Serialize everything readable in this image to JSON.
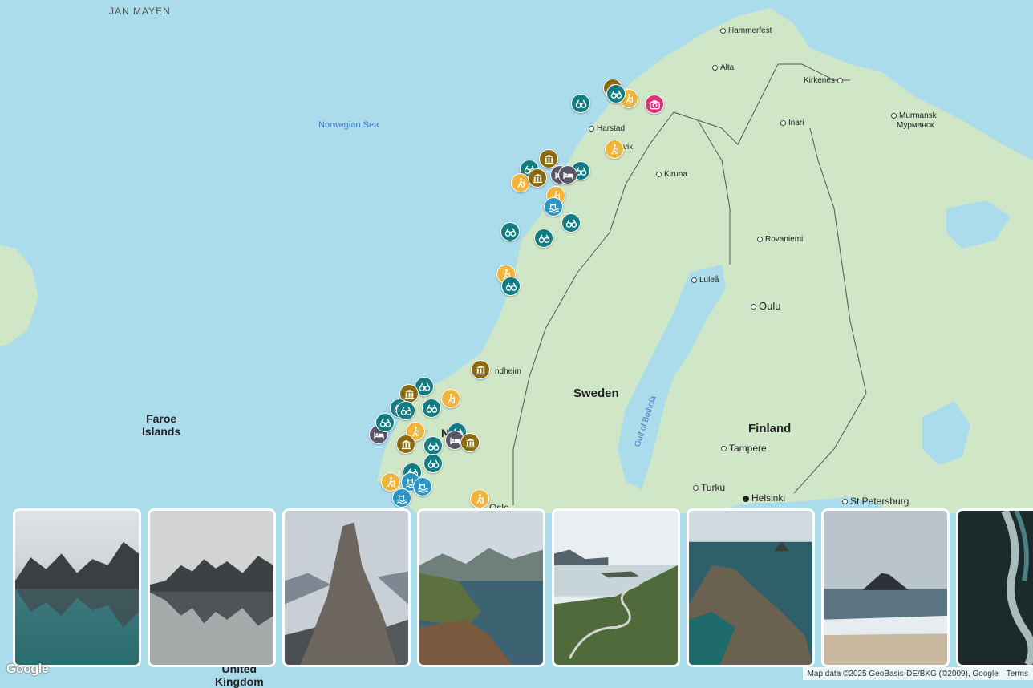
{
  "map": {
    "labels": {
      "jan_mayen": "JAN MAYEN",
      "norwegian_sea": "Norwegian Sea",
      "hammerfest": "Hammerfest",
      "alta": "Alta",
      "kirkenes": "Kirkenes",
      "murmansk_1": "Murmansk",
      "murmansk_2": "Мурманск",
      "inari": "Inari",
      "harstad": "Harstad",
      "narvik_partial": "vik",
      "kiruna": "Kiruna",
      "rovaniemi": "Rovaniemi",
      "lulea": "Luleå",
      "oulu": "Oulu",
      "trondheim_partial": "ndheim",
      "sweden": "Sweden",
      "finland": "Finland",
      "norway_partial": "Nay",
      "gulf_of_bothnia": "Gulf of Bothnia",
      "tampere": "Tampere",
      "turku": "Turku",
      "helsinki": "Helsinki",
      "st_petersburg": "St Petersburg",
      "oslo_partial": "Oslo",
      "faroe_1": "Faroe",
      "faroe_2": "Islands",
      "united_kingdom_1": "United",
      "united_kingdom_2": "Kingdom"
    },
    "pin_colors": {
      "viewpoint": "#117c81",
      "museum": "#8a6a10",
      "hiking": "#f0b43a",
      "lodging": "#5a5668",
      "swimming": "#2b95c4",
      "photo": "#e0307a"
    },
    "pins": [
      {
        "type": "viewpoint",
        "icon": "binoculars-icon"
      },
      {
        "type": "museum",
        "icon": "museum-icon"
      },
      {
        "type": "hiking",
        "icon": "hiking-icon"
      },
      {
        "type": "photo",
        "icon": "camera-icon"
      },
      {
        "type": "viewpoint",
        "icon": "binoculars-icon"
      },
      {
        "type": "hiking",
        "icon": "hiking-icon"
      },
      {
        "type": "museum",
        "icon": "museum-icon"
      },
      {
        "type": "viewpoint",
        "icon": "binoculars-icon"
      },
      {
        "type": "lodging",
        "icon": "bed-icon"
      },
      {
        "type": "viewpoint",
        "icon": "binoculars-icon"
      },
      {
        "type": "hiking",
        "icon": "hiking-icon"
      },
      {
        "type": "hiking",
        "icon": "hiking-icon"
      },
      {
        "type": "swimming",
        "icon": "swimming-icon"
      },
      {
        "type": "viewpoint",
        "icon": "binoculars-icon"
      },
      {
        "type": "viewpoint",
        "icon": "binoculars-icon"
      },
      {
        "type": "viewpoint",
        "icon": "binoculars-icon"
      },
      {
        "type": "hiking",
        "icon": "hiking-icon"
      },
      {
        "type": "viewpoint",
        "icon": "binoculars-icon"
      },
      {
        "type": "museum",
        "icon": "museum-icon"
      },
      {
        "type": "viewpoint",
        "icon": "binoculars-icon"
      },
      {
        "type": "museum",
        "icon": "museum-icon"
      },
      {
        "type": "hiking",
        "icon": "hiking-icon"
      },
      {
        "type": "viewpoint",
        "icon": "binoculars-icon"
      },
      {
        "type": "viewpoint",
        "icon": "binoculars-icon"
      },
      {
        "type": "viewpoint",
        "icon": "binoculars-icon"
      },
      {
        "type": "lodging",
        "icon": "bed-icon"
      },
      {
        "type": "hiking",
        "icon": "hiking-icon"
      },
      {
        "type": "museum",
        "icon": "museum-icon"
      },
      {
        "type": "viewpoint",
        "icon": "binoculars-icon"
      },
      {
        "type": "viewpoint",
        "icon": "binoculars-icon"
      },
      {
        "type": "lodging",
        "icon": "bed-icon"
      },
      {
        "type": "museum",
        "icon": "museum-icon"
      },
      {
        "type": "viewpoint",
        "icon": "binoculars-icon"
      },
      {
        "type": "viewpoint",
        "icon": "binoculars-icon"
      },
      {
        "type": "viewpoint",
        "icon": "binoculars-icon"
      },
      {
        "type": "hiking",
        "icon": "hiking-icon"
      },
      {
        "type": "swimming",
        "icon": "swimming-icon"
      },
      {
        "type": "swimming",
        "icon": "swimming-icon"
      },
      {
        "type": "swimming",
        "icon": "swimming-icon"
      },
      {
        "type": "hiking",
        "icon": "hiking-icon"
      },
      {
        "type": "museum",
        "icon": "museum-icon"
      },
      {
        "type": "lodging",
        "icon": "bed-icon"
      }
    ]
  },
  "carousel": {
    "photos": [
      {
        "name": "photo-glacier-lake-reflection",
        "alt_kind": "mountain lake"
      },
      {
        "name": "photo-calm-lake-peaks",
        "alt_kind": "mountain lake"
      },
      {
        "name": "photo-segla-peak",
        "alt_kind": "mountain peak"
      },
      {
        "name": "photo-hiker-fjord-overlook",
        "alt_kind": "fjord"
      },
      {
        "name": "photo-winding-road-fjord",
        "alt_kind": "road"
      },
      {
        "name": "photo-coastal-cliff-island",
        "alt_kind": "coast"
      },
      {
        "name": "photo-beach-island",
        "alt_kind": "beach"
      },
      {
        "name": "photo-aerial-sea-ice",
        "alt_kind": "aerial"
      }
    ]
  },
  "attribution": {
    "map_data": "Map data ©2025 GeoBasis-DE/BKG (©2009), Google",
    "terms": "Terms",
    "logo": "Google"
  }
}
